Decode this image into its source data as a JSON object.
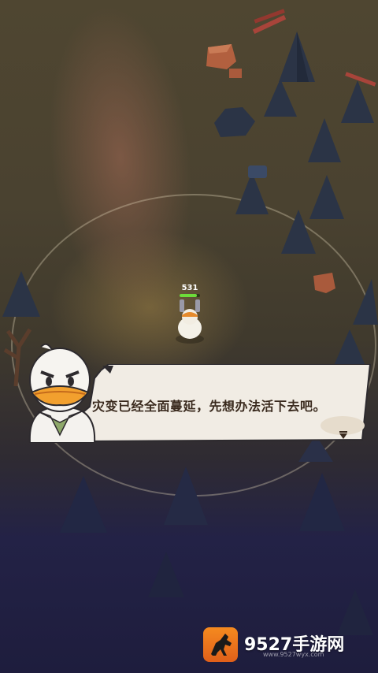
{
  "player": {
    "hp_value": "531",
    "hp_fraction": 0.85
  },
  "dialog": {
    "text": "灾变已经全面蔓延，先想办法活下去吧。",
    "speaker_icon": "duck-scout-avatar",
    "continue_icon": "down-triangle"
  },
  "watermark": {
    "brand": "9527手游网",
    "url": "www.9527wyx.com",
    "icon": "horse-icon"
  },
  "colors": {
    "dialog_bg": "#f1ece4",
    "dialog_text": "#3a2a1e",
    "hp_fill": "#6ddc3a",
    "logo_orange": "#f07a1c"
  }
}
